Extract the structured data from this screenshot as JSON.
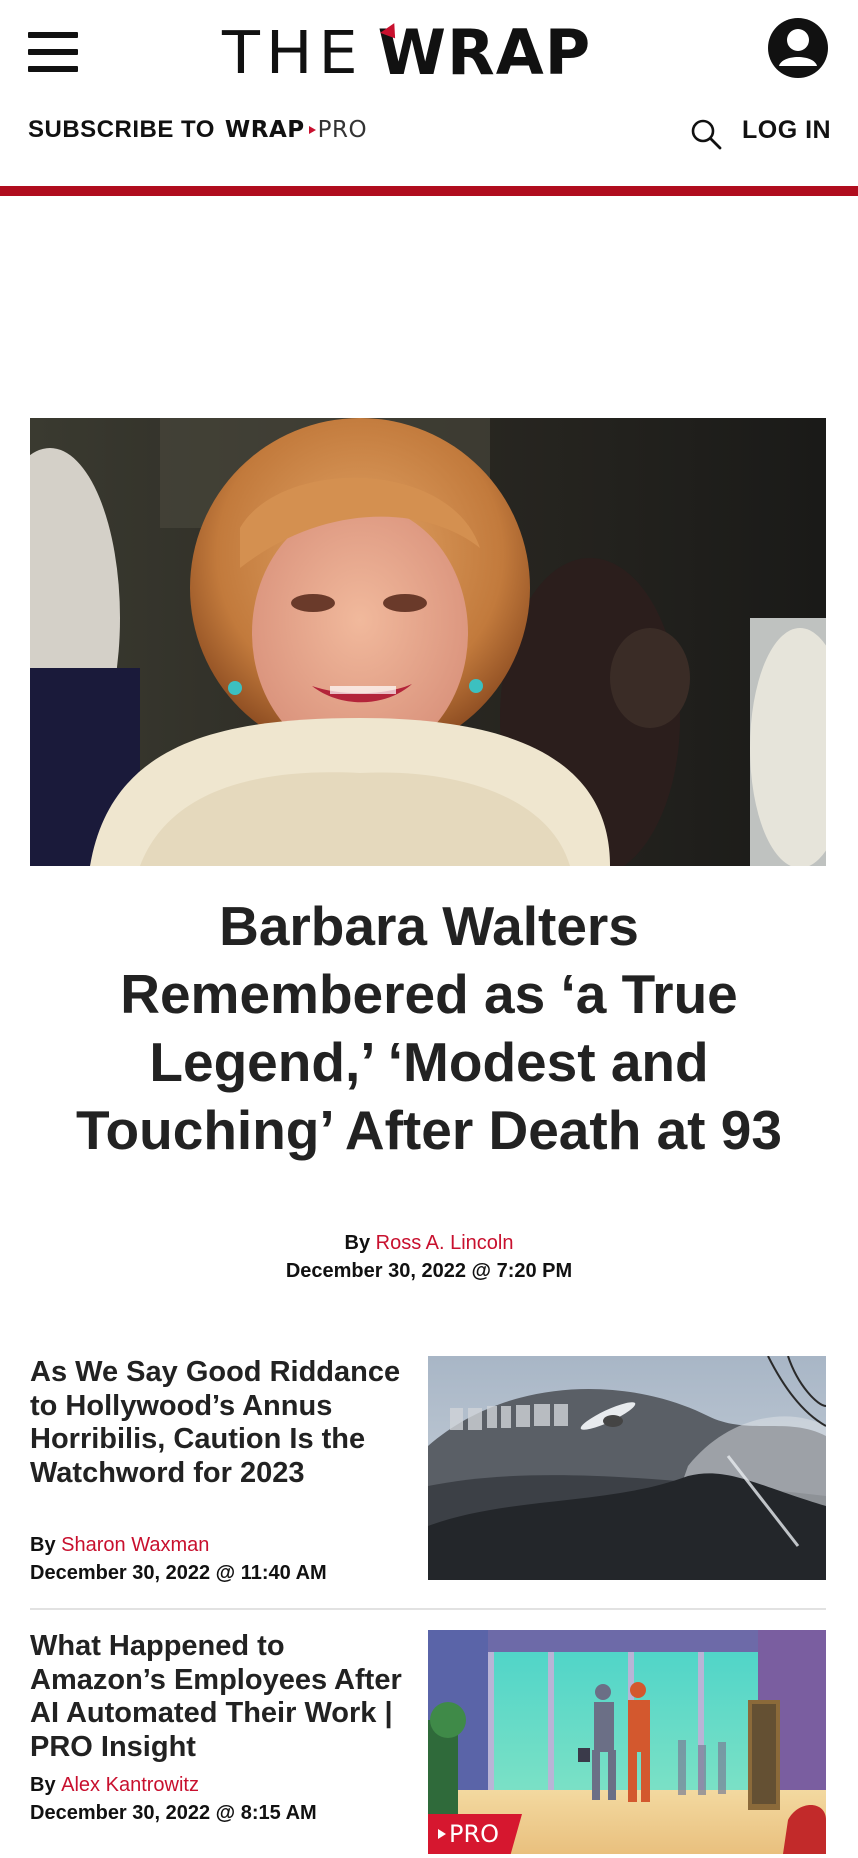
{
  "header": {
    "logo_the": "THE",
    "logo_wrap": "WRAP",
    "subscribe_label": "SUBSCRIBE TO",
    "subscribe_brand_wrap": "WRAP",
    "subscribe_brand_pro": "PRO",
    "login_label": "LOG IN",
    "icons": [
      "hamburger-menu-icon",
      "account-icon",
      "search-icon"
    ]
  },
  "colors": {
    "accent_red": "#c8102e",
    "bar_red": "#b00d1e",
    "text_dark": "#222222"
  },
  "hero": {
    "headline": "Barbara Walters Remembered as ‘a True Legend,’ ‘Modest and Touching’ After Death at 93",
    "by_prefix": "By",
    "author": "Ross A. Lincoln",
    "date": "December 30, 2022 @ 7:20 PM"
  },
  "articles": [
    {
      "title": "As We Say Good Riddance to Hollywood’s Annus Horribilis, Caution Is the Watchword for 2023",
      "by_prefix": "By",
      "author": "Sharon Waxman",
      "date": "December 30, 2022 @ 11:40 AM"
    },
    {
      "title": "What Happened to Amazon’s Employees After AI Automated Their Work | PRO Insight",
      "by_prefix": "By",
      "author": "Alex Kantrowitz",
      "date": "December 30, 2022 @ 8:15 AM",
      "badge": "PRO"
    }
  ]
}
